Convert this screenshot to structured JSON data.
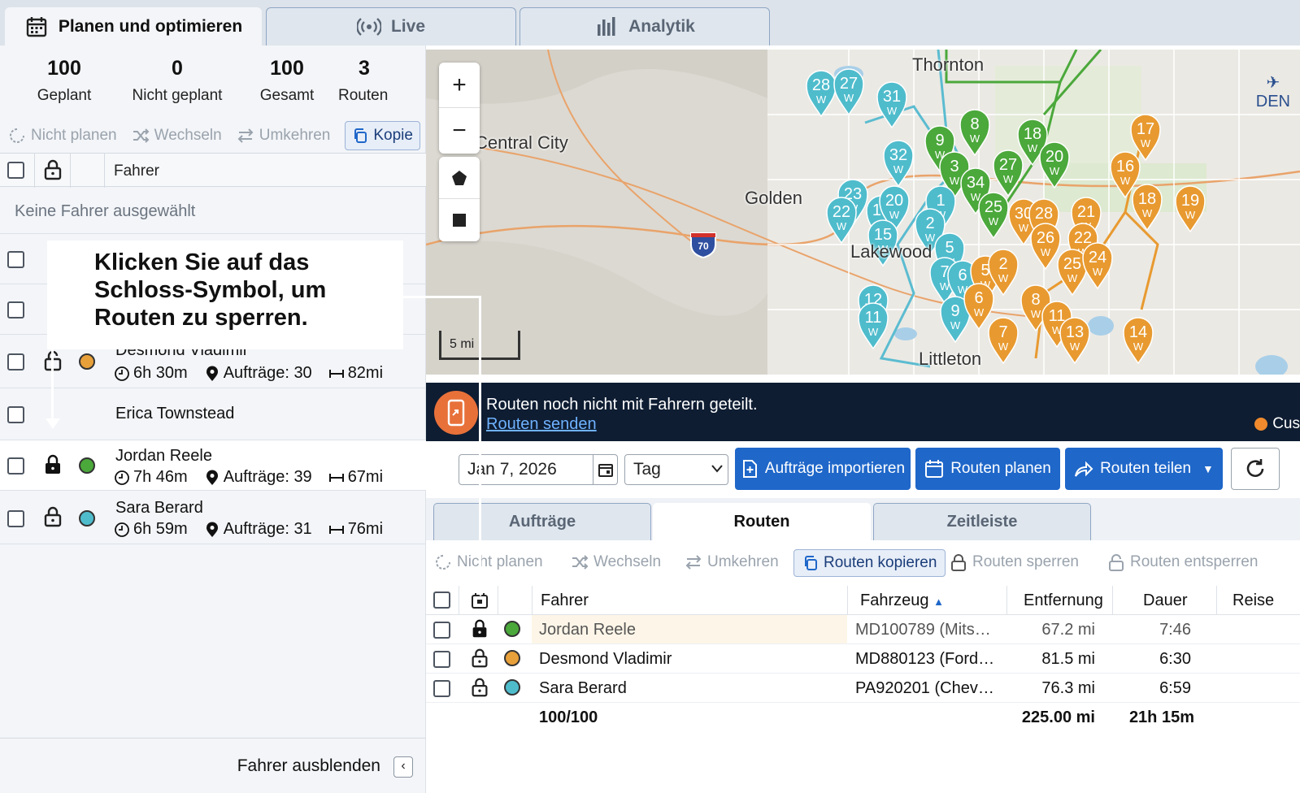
{
  "top_tabs": [
    {
      "label": "Planen und optimieren",
      "icon": "calendar-icon"
    },
    {
      "label": "Live",
      "icon": "broadcast-icon"
    },
    {
      "label": "Analytik",
      "icon": "bar-chart-icon"
    }
  ],
  "stats": [
    {
      "value": "100",
      "label": "Geplant"
    },
    {
      "value": "0",
      "label": "Nicht geplant"
    },
    {
      "value": "100",
      "label": "Gesamt"
    },
    {
      "value": "3",
      "label": "Routen"
    }
  ],
  "left_toolbar": {
    "unplan": "Nicht planen",
    "switch": "Wechseln",
    "reverse": "Umkehren",
    "copy": "Kopie"
  },
  "left_table": {
    "header_driver": "Fahrer",
    "no_drivers": "Keine Fahrer ausgewählt",
    "drivers": [
      {
        "name": "Desmond Vladimir",
        "duration": "6h 30m",
        "orders": "Aufträge: 30",
        "distance": "82mi",
        "color": "#e8a03a"
      },
      {
        "name": "Erica Townstead"
      },
      {
        "name": "Jordan Reele",
        "duration": "7h 46m",
        "orders": "Aufträge: 39",
        "distance": "67mi",
        "color": "#4ba83b"
      },
      {
        "name": "Sara Berard",
        "duration": "6h 59m",
        "orders": "Aufträge: 31",
        "distance": "76mi",
        "color": "#4fbccc"
      }
    ]
  },
  "callout": {
    "text": "Klicken Sie auf das Schloss-Symbol, um Routen zu sperren."
  },
  "left_footer": {
    "label": "Fahrer ausblenden"
  },
  "map": {
    "labels": [
      "Thornton",
      "Central City",
      "Golden",
      "Lakewood",
      "Littleton",
      "DEN"
    ],
    "highway": "70",
    "scale": "5 mi",
    "pins_green": [
      "8",
      "9",
      "18",
      "27",
      "20",
      "3",
      "34",
      "25"
    ],
    "pins_teal": [
      "28",
      "27",
      "31",
      "32",
      "23",
      "22",
      "17",
      "20",
      "15",
      "1",
      "2",
      "5",
      "7",
      "6",
      "12",
      "11",
      "9"
    ],
    "pins_orange": [
      "17",
      "16",
      "19",
      "18",
      "21",
      "30",
      "28",
      "26",
      "22",
      "25",
      "24",
      "5",
      "2",
      "6",
      "8",
      "11",
      "13",
      "7",
      "14"
    ]
  },
  "banner": {
    "message": "Routen noch nicht mit Fahrern geteilt.",
    "link": "Routen senden",
    "legend": "Cus"
  },
  "actionbar": {
    "date": "Jan 7, 2026",
    "period": "Tag",
    "import": "Aufträge importieren",
    "plan": "Routen planen",
    "share": "Routen teilen"
  },
  "bottom_tabs": [
    "Aufträge",
    "Routen",
    "Zeitleiste"
  ],
  "route_toolbar": {
    "unplan": "Nicht planen",
    "switch": "Wechseln",
    "reverse": "Umkehren",
    "copy": "Routen kopieren",
    "lock": "Routen sperren",
    "unlock": "Routen entsperren"
  },
  "routes_table": {
    "headers": {
      "driver": "Fahrer",
      "vehicle": "Fahrzeug",
      "distance": "Entfernung",
      "duration": "Dauer",
      "travel": "Reise"
    },
    "rows": [
      {
        "driver": "Jordan Reele",
        "vehicle": "MD100789 (Mits…",
        "distance": "67.2 mi",
        "duration": "7:46",
        "color": "#4ba83b",
        "locked": true
      },
      {
        "driver": "Desmond Vladimir",
        "vehicle": "MD880123 (Ford…",
        "distance": "81.5 mi",
        "duration": "6:30",
        "color": "#e8a03a",
        "locked": false
      },
      {
        "driver": "Sara Berard",
        "vehicle": "PA920201 (Chev…",
        "distance": "76.3 mi",
        "duration": "6:59",
        "color": "#4fbccc",
        "locked": false
      }
    ],
    "totals": {
      "count": "100/100",
      "distance": "225.00 mi",
      "duration": "21h 15m"
    }
  }
}
